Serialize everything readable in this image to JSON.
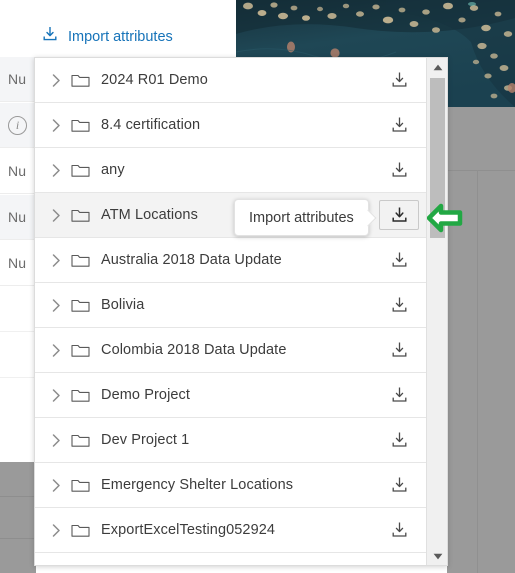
{
  "colors": {
    "link_blue": "#1673b9",
    "annotation_green": "#22a844",
    "row_highlight": "#f3f3f3",
    "scrim_gray": "#9a9a9a",
    "photo_teal": "#1d4150"
  },
  "import_link": {
    "label": "Import attributes",
    "icon": "download-icon"
  },
  "background": {
    "rows": [
      {
        "label": "Nu",
        "shaded": true,
        "icon": null
      },
      {
        "label": "",
        "shaded": true,
        "icon": "info-icon"
      },
      {
        "label": "Nu",
        "shaded": false,
        "icon": null
      },
      {
        "label": "Nu",
        "shaded": true,
        "icon": null
      },
      {
        "label": "Nu",
        "shaded": false,
        "icon": null
      }
    ],
    "info_icon_glyph": "i"
  },
  "dropdown": {
    "items": [
      {
        "name": "2024 R01 Demo",
        "expanded": false,
        "highlighted": false,
        "action_active": false
      },
      {
        "name": "8.4 certification",
        "expanded": false,
        "highlighted": false,
        "action_active": false
      },
      {
        "name": "any",
        "expanded": false,
        "highlighted": false,
        "action_active": false
      },
      {
        "name": "ATM Locations",
        "expanded": false,
        "highlighted": true,
        "action_active": true
      },
      {
        "name": "Australia 2018 Data Update",
        "expanded": false,
        "highlighted": false,
        "action_active": false
      },
      {
        "name": "Bolivia",
        "expanded": false,
        "highlighted": false,
        "action_active": false
      },
      {
        "name": "Colombia 2018 Data Update",
        "expanded": false,
        "highlighted": false,
        "action_active": false
      },
      {
        "name": "Demo Project",
        "expanded": false,
        "highlighted": false,
        "action_active": false
      },
      {
        "name": "Dev Project 1",
        "expanded": false,
        "highlighted": false,
        "action_active": false
      },
      {
        "name": "Emergency Shelter Locations",
        "expanded": false,
        "highlighted": false,
        "action_active": false
      },
      {
        "name": "ExportExcelTesting052924",
        "expanded": false,
        "highlighted": false,
        "action_active": false
      }
    ],
    "row_icons": {
      "expand": "chevron-right-icon",
      "folder": "folder-icon",
      "action": "download-icon"
    },
    "scrollbar": {
      "up_label": "scroll-up",
      "down_label": "scroll-down",
      "thumb_label": "scrollbar-thumb"
    }
  },
  "tooltip": {
    "text": "Import attributes"
  },
  "annotation": {
    "arrow": "left-pointing-arrow",
    "points_to": "Import attributes download button for ATM Locations"
  }
}
